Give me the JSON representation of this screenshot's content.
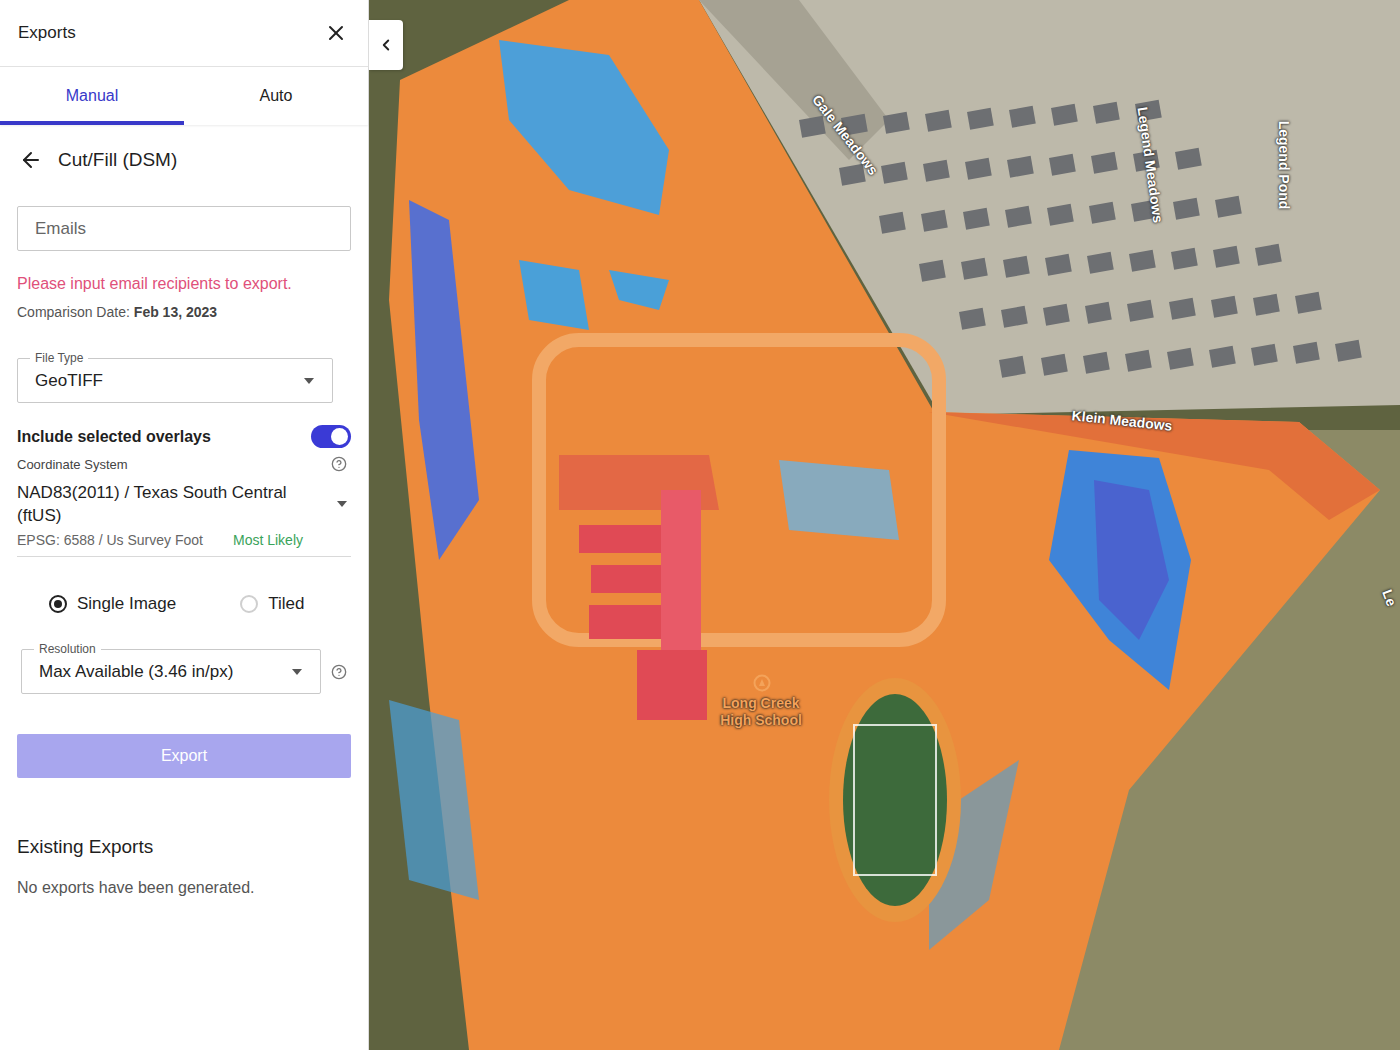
{
  "panel": {
    "title": "Exports"
  },
  "tabs": [
    {
      "label": "Manual",
      "selected": true
    },
    {
      "label": "Auto",
      "selected": false
    }
  ],
  "page": {
    "title": "Cut/Fill (DSM)"
  },
  "emails": {
    "placeholder": "Emails",
    "error": "Please input email recipients to export."
  },
  "comparison": {
    "label": "Comparison Date:",
    "value": "Feb 13, 2023"
  },
  "file_type": {
    "label": "File Type",
    "value": "GeoTIFF"
  },
  "overlays": {
    "label": "Include selected overlays",
    "on": true
  },
  "coordinate_system": {
    "label": "Coordinate System",
    "value": "NAD83(2011) / Texas South Central (ftUS)",
    "detail": "EPSG: 6588 / Us Survey Foot",
    "hint": "Most Likely"
  },
  "output": [
    {
      "label": "Single Image",
      "selected": true
    },
    {
      "label": "Tiled",
      "selected": false
    }
  ],
  "resolution": {
    "label": "Resolution",
    "value": "Max Available (3.46 in/px)"
  },
  "export_button": {
    "label": "Export",
    "disabled": true
  },
  "existing_exports": {
    "title": "Existing Exports",
    "empty": "No exports have been generated."
  },
  "map": {
    "labels": [
      {
        "text": "Gale Meadows"
      },
      {
        "text": "Legend Meadows"
      },
      {
        "text": "Legend Pond"
      },
      {
        "text": "Klein Meadows"
      },
      {
        "text": "Long Creek High School"
      },
      {
        "text": "Le"
      }
    ]
  }
}
